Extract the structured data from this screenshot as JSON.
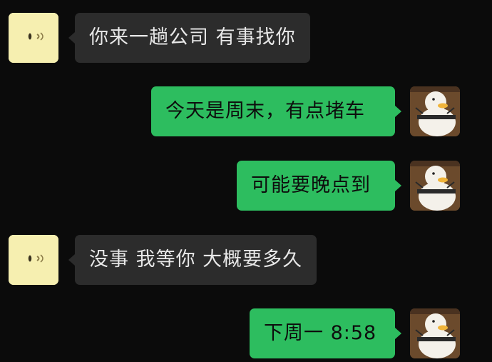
{
  "messages": [
    {
      "side": "left",
      "text": "你来一趟公司 有事找你",
      "avatar": "yellow-face-avatar"
    },
    {
      "side": "right",
      "text": "今天是周末，有点堵车",
      "avatar": "duck-avatar"
    },
    {
      "side": "right",
      "text": "可能要晚点到",
      "avatar": "duck-avatar"
    },
    {
      "side": "left",
      "text": "没事 我等你 大概要多久",
      "avatar": "yellow-face-avatar"
    },
    {
      "side": "right",
      "text": "下周一 8:58",
      "avatar": "duck-avatar"
    }
  ],
  "colors": {
    "background": "#0b0b0b",
    "incoming_bubble": "#2c2c2c",
    "outgoing_bubble": "#2dbd5f",
    "incoming_text": "#e8e8e8",
    "outgoing_text": "#0d0d0d"
  }
}
